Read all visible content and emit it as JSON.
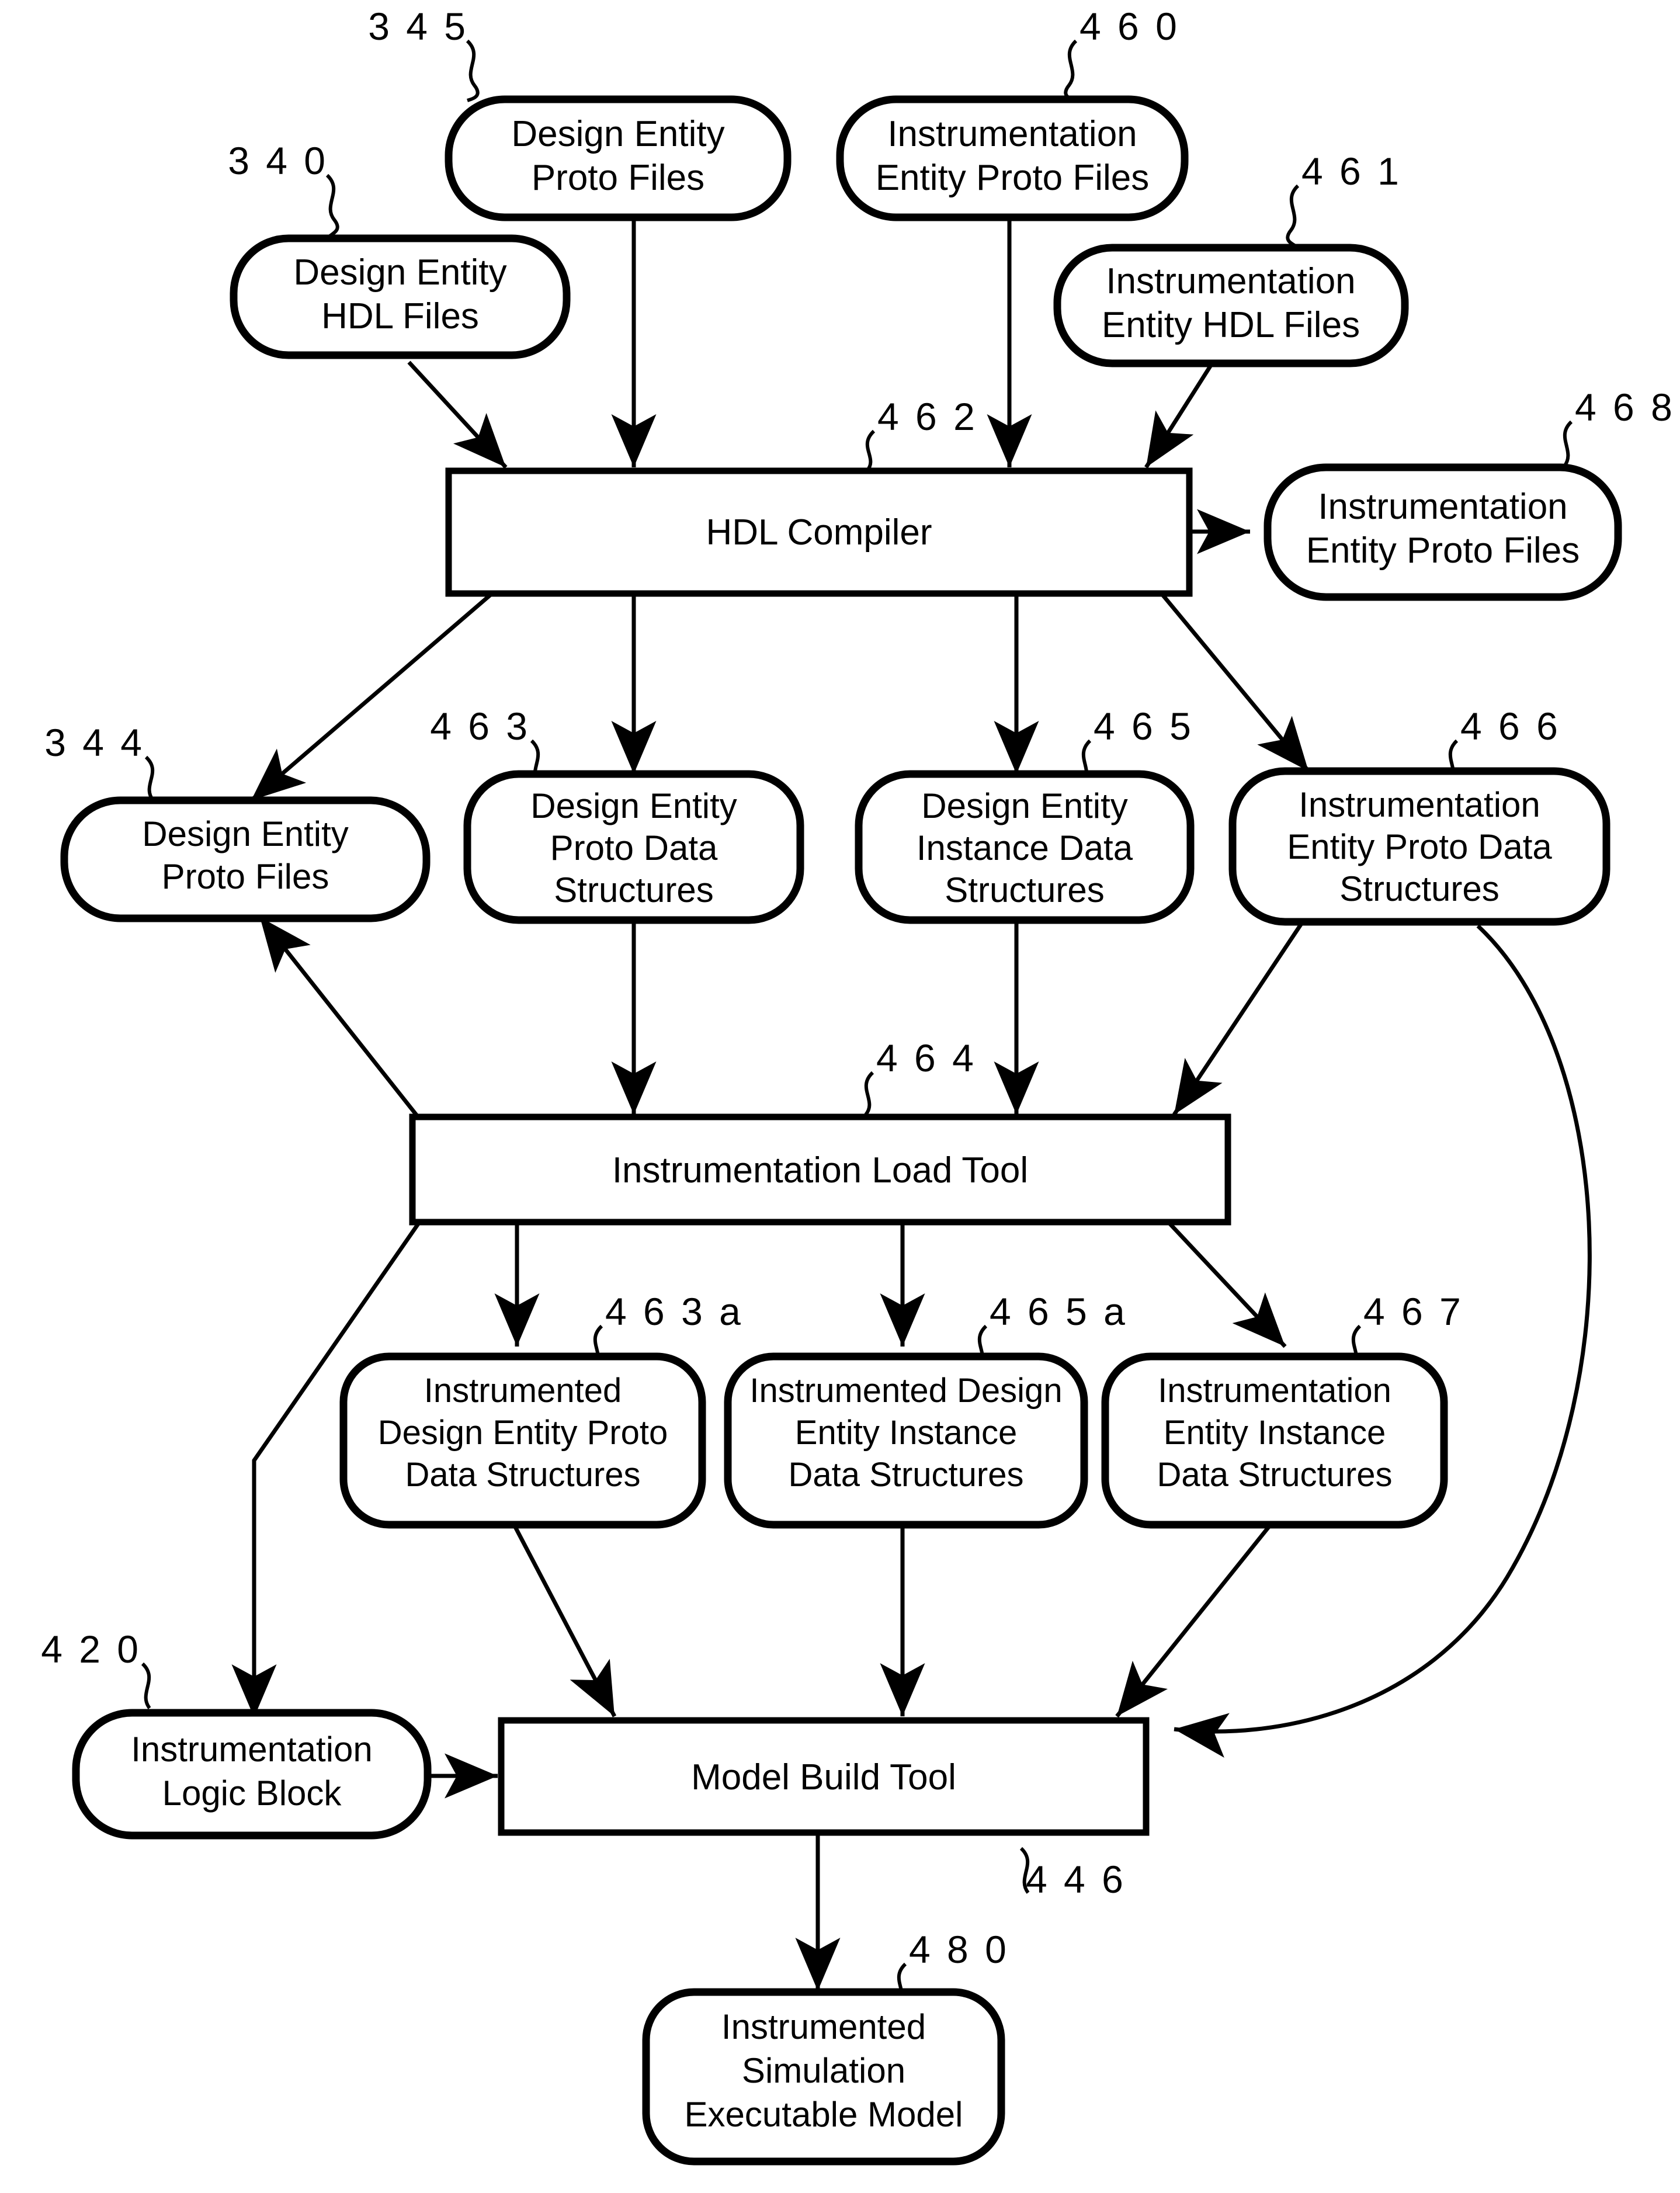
{
  "figure": {
    "kind": "patent-flow-diagram",
    "background_color": "#ffffff",
    "line_color": "#000000",
    "nodes": [
      {
        "id": "345",
        "ref": "3 4 5",
        "shape": "rounded",
        "lines": [
          "Design Entity",
          "Proto Files"
        ]
      },
      {
        "id": "340",
        "ref": "3 4 0",
        "shape": "rounded",
        "lines": [
          "Design Entity",
          "HDL Files"
        ]
      },
      {
        "id": "460",
        "ref": "4 6 0",
        "shape": "rounded",
        "lines": [
          "Instrumentation",
          "Entity Proto Files"
        ]
      },
      {
        "id": "461",
        "ref": "4 6 1",
        "shape": "rounded",
        "lines": [
          "Instrumentation",
          "Entity HDL Files"
        ]
      },
      {
        "id": "462",
        "ref": "4 6 2",
        "shape": "rect",
        "lines": [
          "HDL Compiler"
        ]
      },
      {
        "id": "468",
        "ref": "4 6 8",
        "shape": "rounded",
        "lines": [
          "Instrumentation",
          "Entity Proto Files"
        ]
      },
      {
        "id": "344",
        "ref": "3 4 4",
        "shape": "rounded",
        "lines": [
          "Design Entity",
          "Proto Files"
        ]
      },
      {
        "id": "463",
        "ref": "4 6 3",
        "shape": "rounded",
        "lines": [
          "Design Entity",
          "Proto Data",
          "Structures"
        ]
      },
      {
        "id": "465",
        "ref": "4 6 5",
        "shape": "rounded",
        "lines": [
          "Design Entity",
          "Instance Data",
          "Structures"
        ]
      },
      {
        "id": "466",
        "ref": "4 6 6",
        "shape": "rounded",
        "lines": [
          "Instrumentation",
          "Entity Proto Data",
          "Structures"
        ]
      },
      {
        "id": "464",
        "ref": "4 6 4",
        "shape": "rect",
        "lines": [
          "Instrumentation Load Tool"
        ]
      },
      {
        "id": "463a",
        "ref": "4 6 3 a",
        "shape": "rounded",
        "lines": [
          "Instrumented",
          "Design Entity Proto",
          "Data Structures"
        ]
      },
      {
        "id": "465a",
        "ref": "4 6 5 a",
        "shape": "rounded",
        "lines": [
          "Instrumented Design",
          "Entity Instance",
          "Data Structures"
        ]
      },
      {
        "id": "467",
        "ref": "4 6 7",
        "shape": "rounded",
        "lines": [
          "Instrumentation",
          "Entity Instance",
          "Data Structures"
        ]
      },
      {
        "id": "420",
        "ref": "4 2 0",
        "shape": "rounded",
        "lines": [
          "Instrumentation",
          "Logic Block"
        ]
      },
      {
        "id": "446",
        "ref": "4 4 6",
        "shape": "rect",
        "lines": [
          "Model Build Tool"
        ]
      },
      {
        "id": "480",
        "ref": "4 8 0",
        "shape": "rounded",
        "lines": [
          "Instrumented",
          "Simulation",
          "Executable Model"
        ]
      }
    ],
    "edges": [
      {
        "from": "340",
        "to": "462"
      },
      {
        "from": "345",
        "to": "462"
      },
      {
        "from": "460",
        "to": "462"
      },
      {
        "from": "461",
        "to": "462"
      },
      {
        "from": "462",
        "to": "468"
      },
      {
        "from": "462",
        "to": "344"
      },
      {
        "from": "462",
        "to": "463"
      },
      {
        "from": "462",
        "to": "465"
      },
      {
        "from": "462",
        "to": "466"
      },
      {
        "from": "463",
        "to": "464"
      },
      {
        "from": "465",
        "to": "464"
      },
      {
        "from": "466",
        "to": "464"
      },
      {
        "from": "464",
        "to": "344"
      },
      {
        "from": "464",
        "to": "463a"
      },
      {
        "from": "464",
        "to": "465a"
      },
      {
        "from": "464",
        "to": "467"
      },
      {
        "from": "464",
        "to": "446"
      },
      {
        "from": "463a",
        "to": "446"
      },
      {
        "from": "465a",
        "to": "446"
      },
      {
        "from": "467",
        "to": "446"
      },
      {
        "from": "466",
        "to": "446"
      },
      {
        "from": "420",
        "to": "446"
      },
      {
        "from": "446",
        "to": "480"
      }
    ]
  }
}
